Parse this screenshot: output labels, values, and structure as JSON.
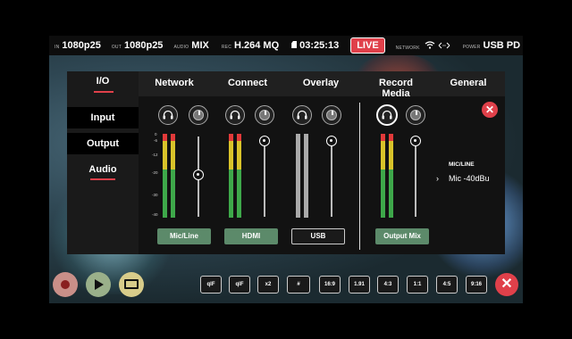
{
  "topbar": {
    "in_label": "IN",
    "in_value": "1080p25",
    "out_label": "OUT",
    "out_value": "1080p25",
    "audio_label": "AUDIO",
    "audio_value": "MIX",
    "rec_label": "REC",
    "rec_value": "H.264 MQ",
    "timer_value": "03:25:13",
    "live_label": "LIVE",
    "network_label": "NETWORK",
    "power_label": "POWER",
    "power_value": "USB PD"
  },
  "io": {
    "title": "I/O",
    "items": [
      "Input",
      "Output",
      "Audio"
    ]
  },
  "tabs": [
    "Network",
    "Connect",
    "Overlay",
    "Record Media",
    "General"
  ],
  "scale_marks": [
    "0",
    "-6",
    "-12",
    "-20",
    "-30",
    "-40"
  ],
  "channels": [
    {
      "label": "Mic/Line",
      "meter_l": 0.78,
      "meter_r": 0.78,
      "fader": 0.52
    },
    {
      "label": "HDMI",
      "meter_l": 0.78,
      "meter_r": 0.78,
      "fader": 0.9
    },
    {
      "label": "USB",
      "meter_l": 1.0,
      "meter_r": 1.0,
      "fader": 0.9
    },
    {
      "label": "Output Mix",
      "meter_l": 0.78,
      "meter_r": 0.78,
      "fader": 0.9
    }
  ],
  "mic": {
    "label": "MIC/LINE",
    "arrow": "›",
    "value": "Mic -40dBu"
  },
  "tools": [
    "qlF",
    "qlF",
    "x2",
    "#",
    "16:9",
    "1.91",
    "4:3",
    "1:1",
    "4:5",
    "9:16"
  ],
  "colors": {
    "accent_red": "#e0404a",
    "green_button": "#5c8a6a"
  }
}
